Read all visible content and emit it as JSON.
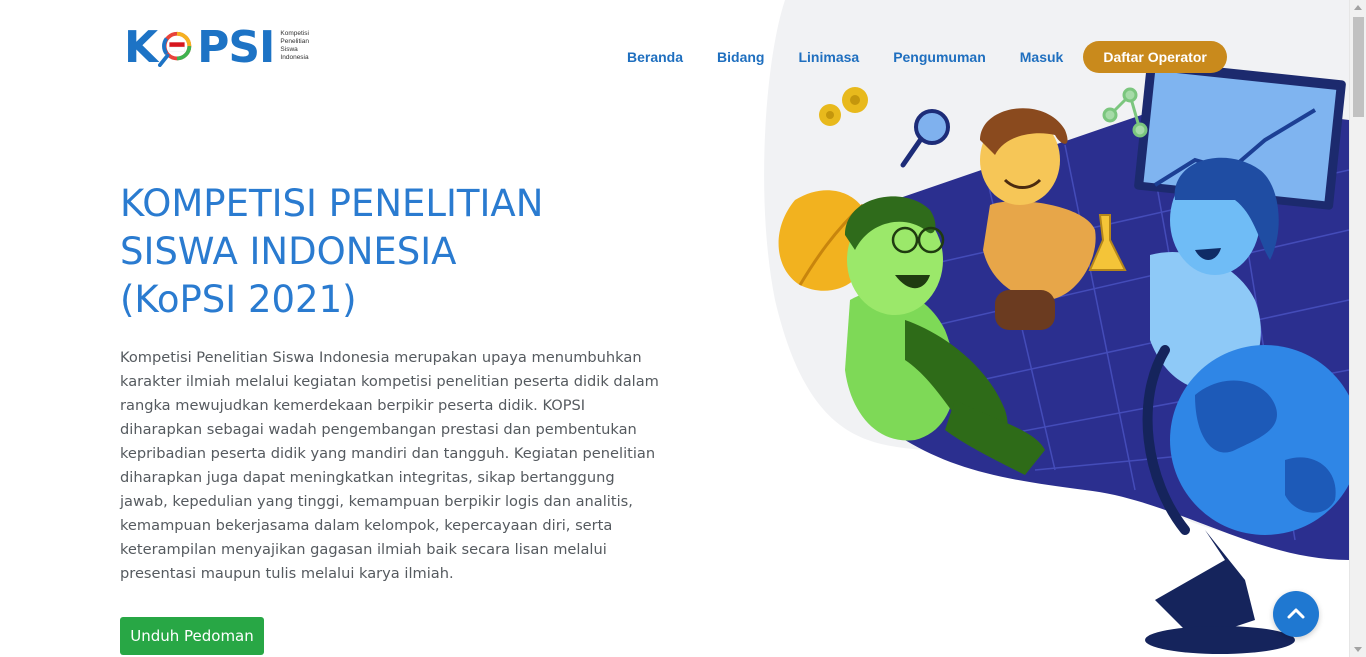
{
  "logo": {
    "wordmark_k": "K",
    "wordmark_rest": "PSI",
    "subtitle_lines": [
      "Kompetisi",
      "Penelitian",
      "Siswa",
      "Indonesia"
    ]
  },
  "nav": {
    "items": [
      {
        "label": "Beranda"
      },
      {
        "label": "Bidang"
      },
      {
        "label": "Linimasa"
      },
      {
        "label": "Pengumuman"
      },
      {
        "label": "Masuk"
      }
    ],
    "cta_label": "Daftar Operator"
  },
  "hero": {
    "title_lines": [
      "KOMPETISI PENELITIAN",
      "SISWA INDONESIA",
      "(KoPSI 2021)"
    ],
    "description": "Kompetisi Penelitian Siswa Indonesia merupakan upaya menumbuhkan karakter ilmiah melalui kegiatan kompetisi penelitian peserta didik dalam rangka mewujudkan kemerdekaan berpikir peserta didik. KOPSI diharapkan sebagai wadah pengembangan prestasi dan pembentukan kepribadian peserta didik yang mandiri dan tangguh. Kegiatan penelitian diharapkan juga dapat meningkatkan integritas, sikap bertanggung jawab, kepedulian yang tinggi, kemampuan berpikir logis dan analitis, kemampuan bekerjasama dalam kelompok, kepercayaan diri, serta keterampilan menyajikan gagasan ilmiah baik secara lisan melalui presentasi maupun tulis melalui karya ilmiah.",
    "download_button": "Unduh Pedoman"
  },
  "icons": {
    "back_to_top": "chevron-up-icon",
    "logo_magnifier": "magnifier-icon"
  },
  "colors": {
    "primary_blue": "#2a7bd0",
    "nav_blue": "#1f6fbf",
    "cta_gold": "#c98a1c",
    "download_green": "#28a745",
    "body_text": "#555a5f"
  }
}
